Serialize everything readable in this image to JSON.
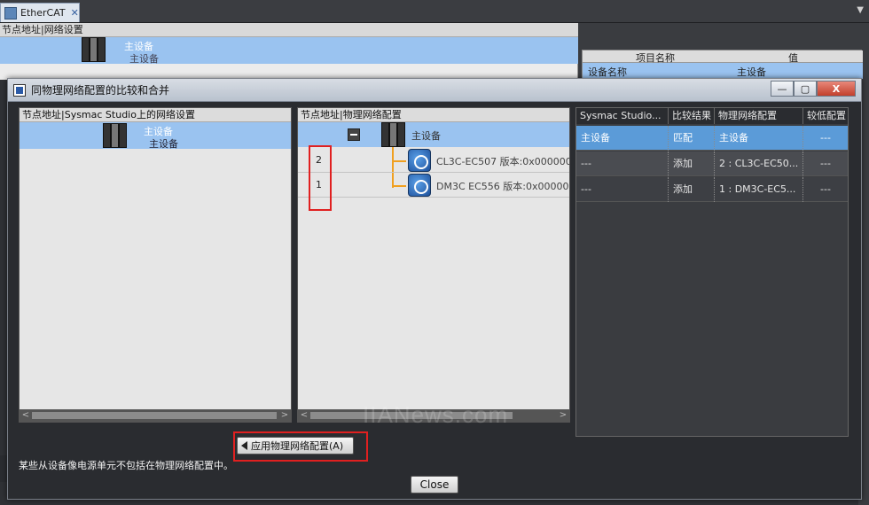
{
  "app": {
    "tab_label": "EtherCAT",
    "close_glyph": "✕",
    "dropdown_glyph": "▼"
  },
  "background": {
    "left_header": "节点地址|网络设置",
    "master_label": "主设备",
    "master_sub": "主设备",
    "prop_table": {
      "col_name": "项目名称",
      "col_value": "值",
      "row_name": "设备名称",
      "row_value": "主设备"
    }
  },
  "dialog": {
    "title": "同物理网络配置的比较和合并",
    "minimize_glyph": "—",
    "maximize_glyph": "▢",
    "close_glyph": "X",
    "left_pane": {
      "header": "节点地址|Sysmac Studio上的网络设置",
      "master_name": "主设备",
      "master_sub": "主设备"
    },
    "mid_pane": {
      "header": "节点地址|物理网络配置",
      "master_name": "主设备",
      "slaves": [
        {
          "address": "2",
          "name": "CL3C-EC507 版本:0x000000"
        },
        {
          "address": "1",
          "name": "DM3C EC556 版本:0x00000"
        }
      ]
    },
    "compare_table": {
      "columns": [
        "Sysmac Studio...",
        "比较结果",
        "物理网络配置",
        "较低配置"
      ],
      "rows": [
        {
          "studio": "主设备",
          "result": "匹配",
          "physical": "主设备",
          "lower": "---"
        },
        {
          "studio": "---",
          "result": "添加",
          "physical": "2 : CL3C-EC50...",
          "lower": "---"
        },
        {
          "studio": "---",
          "result": "添加",
          "physical": "1 : DM3C-EC5...",
          "lower": "---"
        }
      ]
    },
    "apply_button": "应用物理网络配置(A)",
    "note": "某些从设备像电源单元不包括在物理网络配置中。",
    "close_button": "Close",
    "watermark": "IIANews.com"
  },
  "colors": {
    "selection": "#9ac3f0",
    "highlight_box": "#e02020",
    "tree_line": "#f0a020"
  }
}
